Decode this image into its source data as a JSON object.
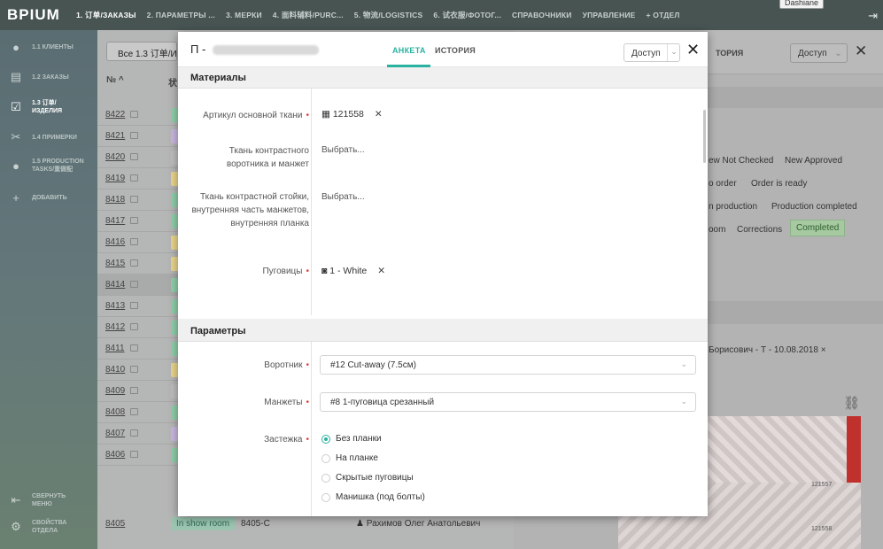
{
  "app": {
    "logo": "BPIUM",
    "user_tooltip": "Dashiane"
  },
  "nav": [
    "1. 订单/ЗАКАЗЫ",
    "2. ПАРАМЕТРЫ ...",
    "3. МЕРКИ",
    "4. 面料辅料/PURC...",
    "5. 物流/LOGISTICS",
    "6. 试衣服/ФОТОГ...",
    "СПРАВОЧНИКИ",
    "УПРАВЛЕНИЕ",
    "+ ОТДЕЛ"
  ],
  "sidebar": {
    "items": [
      {
        "label": "1.1 КЛИЕНТЫ",
        "icon": "person-icon"
      },
      {
        "label": "1.2 ЗАКАЗЫ",
        "icon": "cart-icon"
      },
      {
        "label": "1.3 订单/ИЗДЕЛИЯ",
        "icon": "check-square-icon"
      },
      {
        "label": "1.4 ПРИМЕРКИ",
        "icon": "scissors-icon"
      },
      {
        "label": "1.5 PRODUCTION TASKS/重做配",
        "icon": "bulb-icon"
      },
      {
        "label": "ДОБАВИТЬ",
        "icon": "plus-icon"
      }
    ],
    "collapse": "СВЕРНУТЬ МЕНЮ",
    "settings": "СВОЙСТВА ОТДЕЛА"
  },
  "list": {
    "filter": "Все 1.3 订单/И:",
    "col_num": "№ ^",
    "col_status": "状",
    "rows": [
      {
        "num": "8422",
        "chip": "#8fcfa9"
      },
      {
        "num": "8421",
        "chip": "#c9b6e0"
      },
      {
        "num": "8420",
        "chip": "#bdbdbd"
      },
      {
        "num": "8419",
        "chip": "#e8d48a"
      },
      {
        "num": "8418",
        "chip": "#8fcfa9"
      },
      {
        "num": "8417",
        "chip": "#8fcfa9"
      },
      {
        "num": "8416",
        "chip": "#e8d48a"
      },
      {
        "num": "8415",
        "chip": "#e8d48a"
      },
      {
        "num": "8414",
        "chip": "#8fcfa9"
      },
      {
        "num": "8413",
        "chip": "#8fcfa9"
      },
      {
        "num": "8412",
        "chip": "#8fcfa9"
      },
      {
        "num": "8411",
        "chip": "#8fcfa9"
      },
      {
        "num": "8410",
        "chip": "#e8d48a"
      },
      {
        "num": "8409",
        "chip": "#bdbdbd"
      },
      {
        "num": "8408",
        "chip": "#8fcfa9"
      },
      {
        "num": "8407",
        "chip": "#c9b6e0"
      },
      {
        "num": "8406",
        "chip": "#8fcfa9"
      }
    ],
    "last_row": {
      "num": "8405",
      "status": "In show room",
      "code": "8405-C",
      "person": "Рахимов Олег Анатольевич"
    }
  },
  "right": {
    "tab": "ТОРИЯ",
    "access": "Доступ",
    "statuses": [
      [
        "ew Not Checked",
        "New Approved"
      ],
      [
        "o order",
        "Order is ready"
      ],
      [
        "n production",
        "Production completed"
      ],
      [
        "oom",
        "Corrections"
      ]
    ],
    "status_active": "Completed",
    "person": "Борисович - Т - 10.08.2018  ×",
    "fabric_labels": [
      "121557",
      "121558"
    ]
  },
  "modal": {
    "title_prefix": "П -",
    "tabs": [
      "АНКЕТА",
      "ИСТОРИЯ"
    ],
    "access": "Доступ",
    "sections": {
      "materials": "Материалы",
      "params": "Параметры"
    },
    "fields": {
      "main_fabric_label": "Артикул основной ткани",
      "main_fabric_value": "121558",
      "contrast_collar_label": "Ткань контрастного воротника и манжет",
      "contrast_collar_value": "Выбрать...",
      "contrast_stand_label": "Ткань контрастной стойки, внутренняя часть манжетов, внутренняя планка",
      "contrast_stand_value": "Выбрать...",
      "buttons_label": "Пуговицы",
      "buttons_value": "1 - White",
      "collar_label": "Воротник",
      "collar_value": "#12 Cut-away (7.5см)",
      "cuffs_label": "Манжеты",
      "cuffs_value": "#8 1-пуговица срезанный",
      "closure_label": "Застежка",
      "closure_options": [
        "Без планки",
        "На планке",
        "Скрытые пуговицы",
        "Манишка (под болты)"
      ]
    }
  }
}
